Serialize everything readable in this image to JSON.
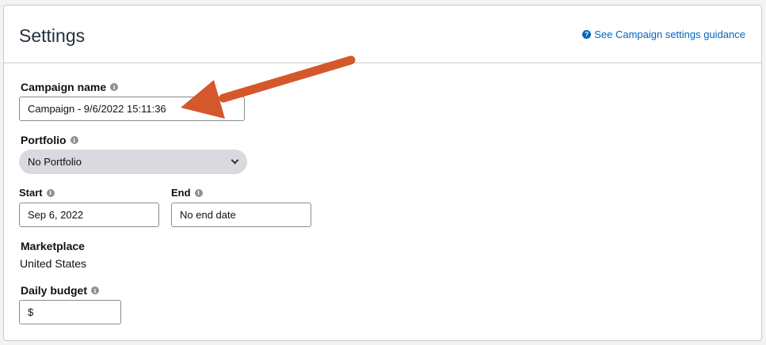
{
  "header": {
    "title": "Settings",
    "guidance_link": "See Campaign settings guidance"
  },
  "campaign_name": {
    "label": "Campaign name",
    "value": "Campaign - 9/6/2022 15:11:36"
  },
  "portfolio": {
    "label": "Portfolio",
    "selected": "No Portfolio"
  },
  "start": {
    "label": "Start",
    "value": "Sep 6, 2022"
  },
  "end": {
    "label": "End",
    "value": "No end date"
  },
  "marketplace": {
    "label": "Marketplace",
    "value": "United States"
  },
  "daily_budget": {
    "label": "Daily budget",
    "currency_symbol": "$",
    "value": ""
  },
  "icons": {
    "info": "i",
    "question": "?"
  },
  "colors": {
    "link": "#0066c0",
    "annotation_arrow": "#d4582b",
    "select_bg": "#d8dadf"
  }
}
